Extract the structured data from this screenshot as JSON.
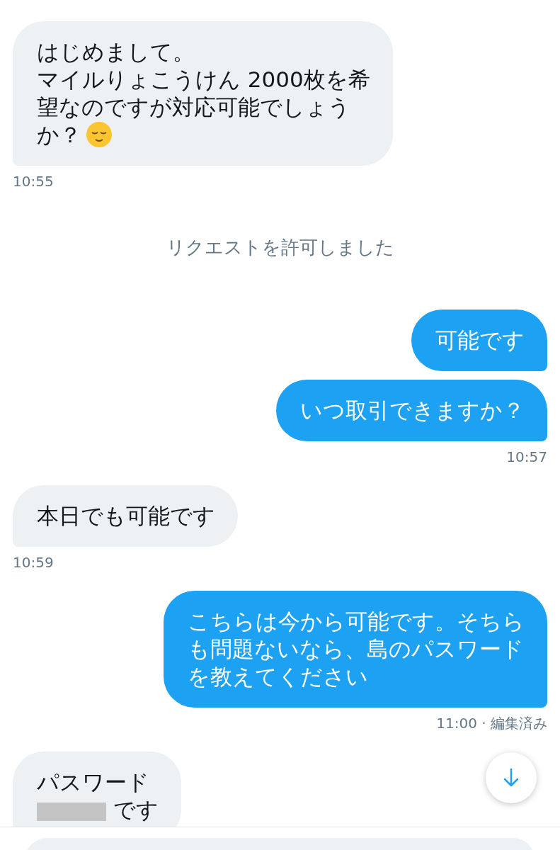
{
  "messages": [
    {
      "kind": "received",
      "parts": [
        {
          "kind": "text",
          "text": "はじめまして。"
        },
        {
          "kind": "break"
        },
        {
          "kind": "text",
          "text": "マイルりょこうけん 2000枚を希"
        },
        {
          "kind": "break"
        },
        {
          "kind": "text",
          "text": "望なのですが対応可能でしょう"
        },
        {
          "kind": "break"
        },
        {
          "kind": "text",
          "text": "か？"
        },
        {
          "kind": "emoji"
        }
      ],
      "time": "10:55"
    },
    {
      "kind": "system",
      "text": "リクエストを許可しました"
    },
    {
      "kind": "sent",
      "parts": [
        {
          "kind": "text",
          "text": "可能です"
        }
      ]
    },
    {
      "kind": "sent",
      "parts": [
        {
          "kind": "text",
          "text": "いつ取引できますか？"
        }
      ],
      "time": "10:57"
    },
    {
      "kind": "received",
      "parts": [
        {
          "kind": "text",
          "text": "本日でも可能です"
        }
      ],
      "time": "10:59"
    },
    {
      "kind": "sent",
      "parts": [
        {
          "kind": "text",
          "text": "こちらは今から可能です。そちら"
        },
        {
          "kind": "break"
        },
        {
          "kind": "text",
          "text": "も問題ないなら、島のパスワード"
        },
        {
          "kind": "break"
        },
        {
          "kind": "text",
          "text": "を教えてください"
        }
      ],
      "time": "11:00 · 編集済み"
    },
    {
      "kind": "received",
      "parts": [
        {
          "kind": "text",
          "text": "パスワード"
        },
        {
          "kind": "break"
        },
        {
          "kind": "redacted"
        },
        {
          "kind": "text",
          "text": " です"
        }
      ]
    }
  ]
}
